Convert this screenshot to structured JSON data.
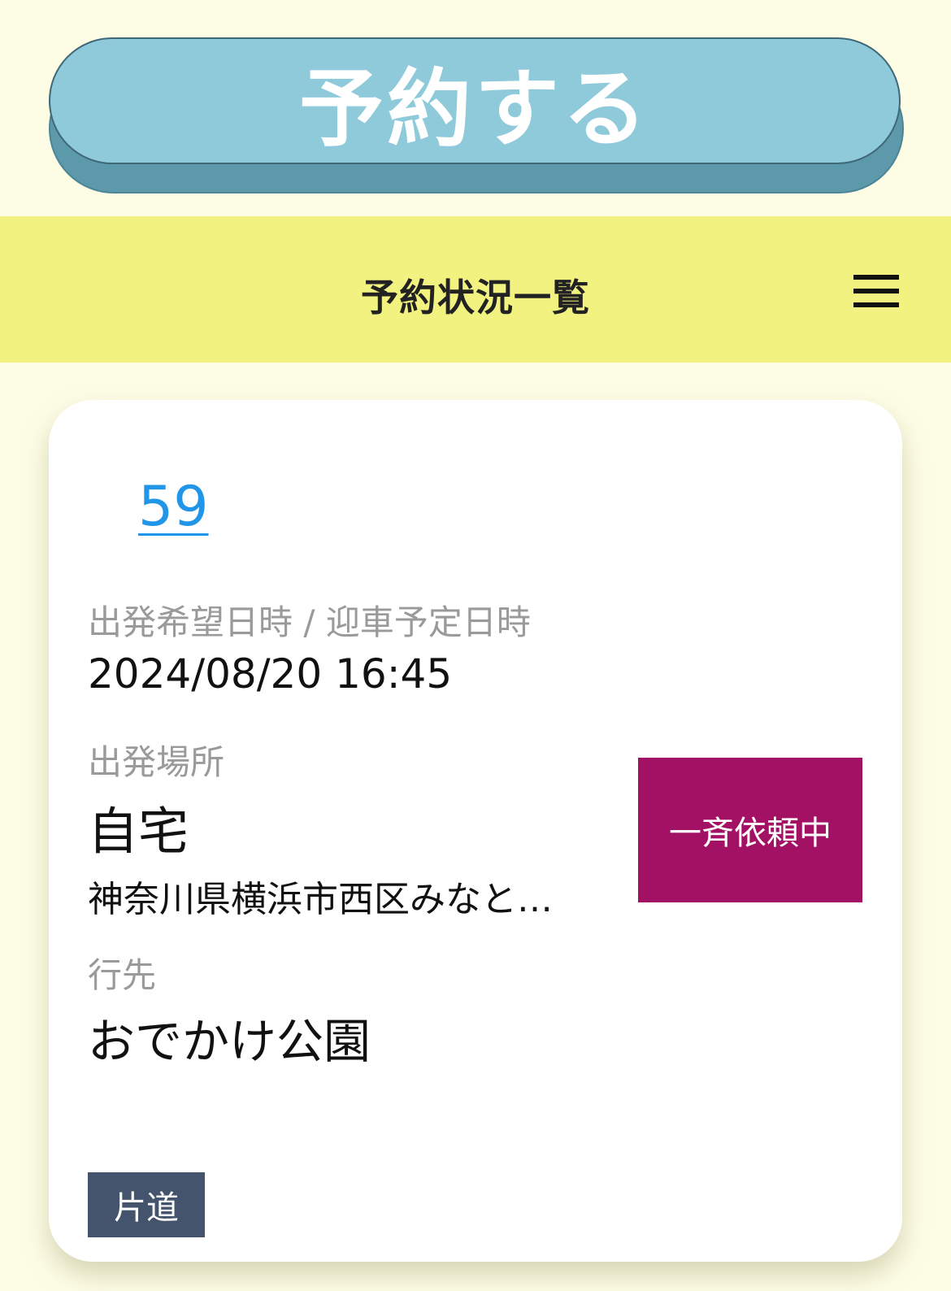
{
  "reserve_button": {
    "label": "予約する"
  },
  "header": {
    "title": "予約状況一覧",
    "menu_icon": "hamburger-menu-icon"
  },
  "reservation": {
    "id": "59",
    "departure_datetime": {
      "label": "出発希望日時 / 迎車予定日時",
      "value": "2024/08/20 16:45"
    },
    "departure_place": {
      "label": "出発場所",
      "name": "自宅",
      "address": "神奈川県横浜市西区みなと…"
    },
    "destination": {
      "label": "行先",
      "name": "おでかけ公園"
    },
    "status": "一斉依頼中",
    "trip_type": "片道"
  },
  "colors": {
    "page_background": "#fdfde6",
    "reserve_button": "#8fcadb",
    "reserve_button_shadow": "#5c99ab",
    "header_background": "#f2f280",
    "link": "#2196e8",
    "status_badge": "#a31165",
    "trip_tag": "#45546d"
  }
}
